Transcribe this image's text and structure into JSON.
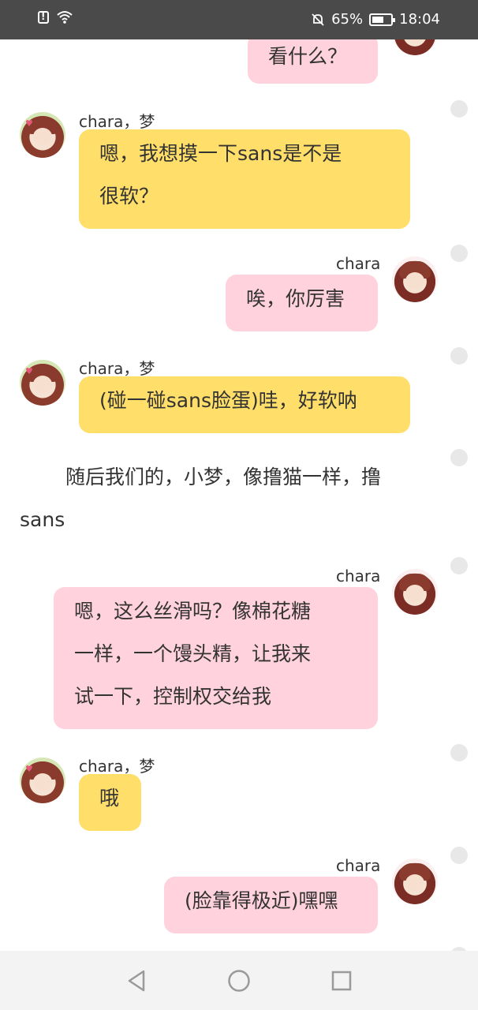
{
  "status_bar": {
    "battery_percent": "65%",
    "time": "18:04"
  },
  "messages": [
    {
      "sender": "",
      "text": "看什么？",
      "side": "right"
    },
    {
      "sender": "chara，梦",
      "text": "嗯，我想摸一下sans是不是\n很软？",
      "side": "left"
    },
    {
      "sender": "chara",
      "text": "唉，你厉害",
      "side": "right"
    },
    {
      "sender": "chara，梦",
      "text": "(碰一碰sans脸蛋)哇，好软呐",
      "side": "left"
    },
    {
      "sender": "chara",
      "text": "嗯，这么丝滑吗？像棉花糖\n一样，一个馒头精，让我来\n试一下，控制权交给我",
      "side": "right"
    },
    {
      "sender": "chara，梦",
      "text": "哦",
      "side": "left"
    },
    {
      "sender": "chara",
      "text": "(脸靠得极近)嘿嘿",
      "side": "right"
    }
  ],
  "narration": {
    "line1": "随后我们的，小梦，像撸猫一样，撸",
    "line2": "sans"
  },
  "colors": {
    "left_bubble": "#ffde6a",
    "right_bubble": "#ffd2dd",
    "status_bar": "#4a4a4a"
  }
}
